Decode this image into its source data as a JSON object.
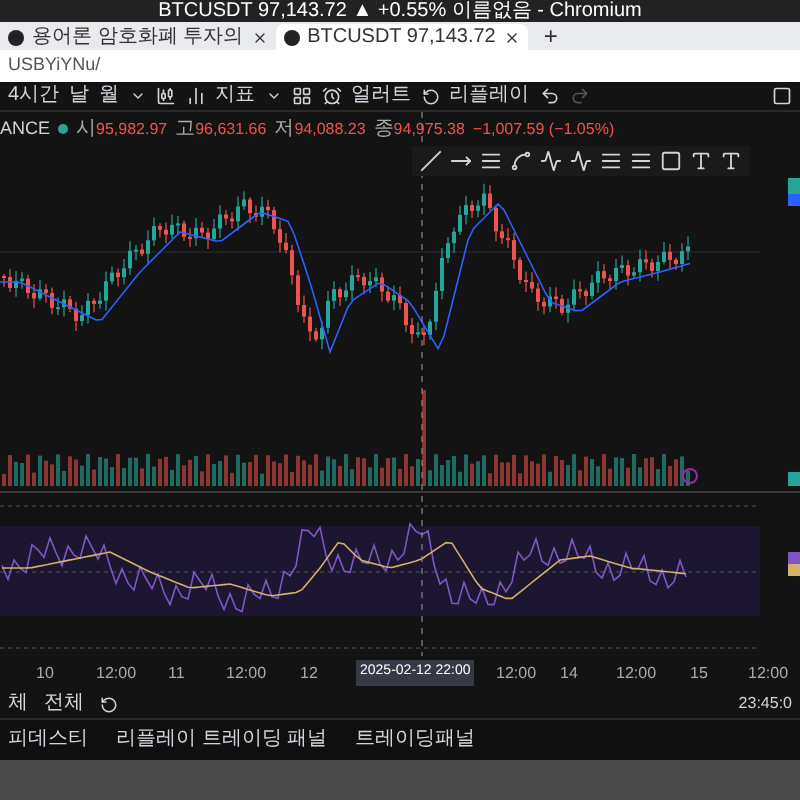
{
  "window": {
    "title": "BTCUSDT 97,143.72 ▲ +0.55% 이름없음 - Chromium"
  },
  "tabs": [
    {
      "label": "용어론 암호화폐 투자의",
      "selected": false
    },
    {
      "label": "BTCUSDT 97,143.72",
      "selected": true
    }
  ],
  "new_tab": "+",
  "address_bar": {
    "url": "USBYiYNu/"
  },
  "toolbar": {
    "interval": "4시간",
    "periods": [
      "날",
      "월"
    ],
    "indicators": "지표",
    "alert": "얼러트",
    "replay": "리플레이"
  },
  "legend": {
    "symbol": "ANCE",
    "values": [
      {
        "label": "시",
        "value": "95,982.97"
      },
      {
        "label": "고",
        "value": "96,631.66"
      },
      {
        "label": "저",
        "value": "94,088.23"
      },
      {
        "label": "종",
        "value": "94,975.38"
      }
    ],
    "change": "−1,007.59 (−1.05%)"
  },
  "time_axis": [
    "10",
    "12:00",
    "11",
    "12:00",
    "12",
    "12:00",
    "14",
    "12:00",
    "15",
    "12:00"
  ],
  "crosshair_label": "2025-02-12 22:00",
  "bottom_bar": {
    "ranges": [
      "체",
      "전체"
    ],
    "clock": "23:45:0"
  },
  "panel_tabs": [
    "피데스티",
    "리플레이 트레이딩 패널",
    "트레이딩패널"
  ]
}
